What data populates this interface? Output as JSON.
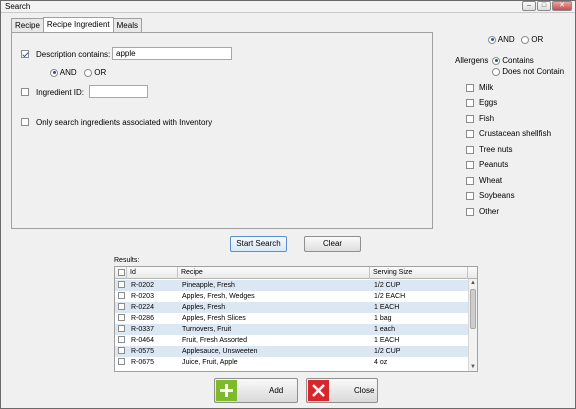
{
  "window": {
    "title": "Search",
    "min_icon": "minimize-icon",
    "max_icon": "maximize-icon",
    "close_icon": "close-icon"
  },
  "tabs": [
    "Recipe",
    "Recipe Ingredient",
    "Meals"
  ],
  "active_tab": "Recipe Ingredient",
  "form": {
    "description_label": "Description contains:",
    "description_value": "apple",
    "description_checked": true,
    "and_label": "AND",
    "or_label": "OR",
    "and_selected": true,
    "ingredient_id_label": "Ingredient ID:",
    "ingredient_id_value": "",
    "inventory_label": "Only search ingredients associated with Inventory"
  },
  "top_logic": {
    "and_label": "AND",
    "or_label": "OR",
    "and_selected": true
  },
  "allergens": {
    "label": "Allergens",
    "contains_label": "Contains",
    "not_contains_label": "Does not Contain",
    "items": [
      "Milk",
      "Eggs",
      "Fish",
      "Crustacean shellfish",
      "Tree nuts",
      "Peanuts",
      "Wheat",
      "Soybeans",
      "Other"
    ]
  },
  "buttons": {
    "start_search": "Start Search",
    "clear": "Clear",
    "add": "Add",
    "close": "Close"
  },
  "results": {
    "label": "Results:",
    "columns": [
      "Id",
      "Recipe",
      "Serving Size"
    ],
    "rows": [
      {
        "id": "R-0202",
        "recipe": "Pineapple, Fresh",
        "size": "1/2 CUP"
      },
      {
        "id": "R-0203",
        "recipe": "Apples, Fresh, Wedges",
        "size": "1/2 EACH"
      },
      {
        "id": "R-0224",
        "recipe": "Apples, Fresh",
        "size": "1 EACH"
      },
      {
        "id": "R-0286",
        "recipe": "Apples, Fresh Slices",
        "size": "1 bag"
      },
      {
        "id": "R-0337",
        "recipe": "Turnovers, Fruit",
        "size": "1 each"
      },
      {
        "id": "R-0464",
        "recipe": "Fruit, Fresh Assorted",
        "size": "1 EACH"
      },
      {
        "id": "R-0575",
        "recipe": "Applesauce, Unsweeten",
        "size": "1/2 CUP"
      },
      {
        "id": "R-0675",
        "recipe": "Juice, Fruit, Apple",
        "size": "4 oz"
      }
    ]
  },
  "colors": {
    "row_alt": "#dbe8f4",
    "add_green": "#7dbb2b",
    "close_red": "#d7262c"
  }
}
